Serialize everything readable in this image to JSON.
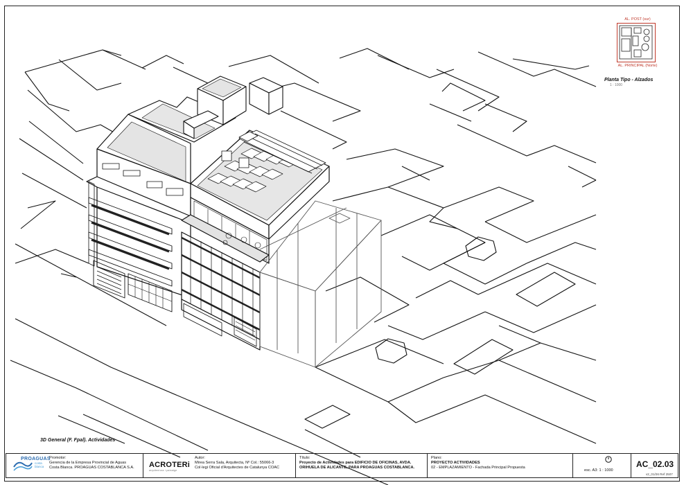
{
  "drawing": {
    "caption": "3D General (F. Fpal). Actividades"
  },
  "keyplan": {
    "label_top": "AL. POST (sur)",
    "label_bottom": "AL. PRINCIPAL (Norte)",
    "title": "Planta Tipo - Alzados",
    "scale": "1 : 1000",
    "accent_color": "#c0392b"
  },
  "title_block": {
    "logo_promoter": {
      "text": "PROAGUAS",
      "subtext": "costa blanca"
    },
    "promoter": {
      "label": "Promotor:",
      "line1": "Gerencia de la Empresa Provincial de Aguas",
      "line2": "Costa Blanca.  PROAGUAS COSTABLANCA S.A."
    },
    "logo_author": {
      "text": "ACROTERi",
      "subtext": "arquitectura i paisatge"
    },
    "author": {
      "label": "Autor:",
      "line1": "Mirea Serra Sala, Arquitecta, Nº Col.: 55066-3",
      "line2": "Col·legi Oficial d'Arquitectes de Catalunya COAC"
    },
    "title": {
      "label": "Título:",
      "line1": "Proyecto de Actividades para EDIFICIO DE OFICINAS, AVDA.",
      "line2": "ORIHUELA DE ALICANTE, PARA PROAGUAS COSTABLANCA."
    },
    "plan": {
      "label": "Plano:",
      "line1": "PROYECTO ACTIVIDADES",
      "line2": "02 - EMPLAZAMIENTO -  Fachada Principal Propuesta"
    },
    "scale": {
      "text": "esc. A3:  1 : 1000"
    },
    "code": {
      "number": "AC_02.03",
      "version": "v2_01/26 Ref 2507"
    }
  }
}
